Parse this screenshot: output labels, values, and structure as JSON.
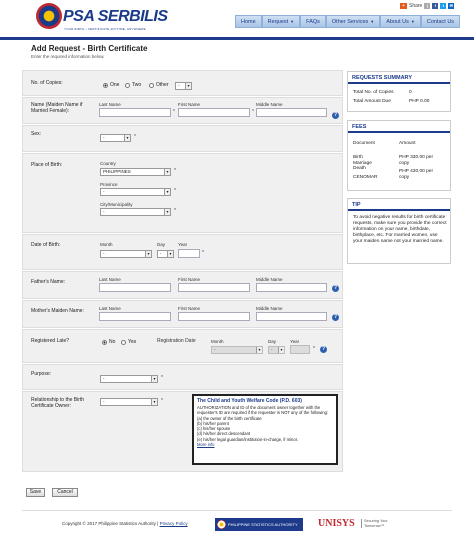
{
  "header": {
    "logo_text": "PSA SERBILIS",
    "tagline": "YOUR BIRTH • CERTIFICATE ANYTIME, ANYWHERE",
    "share_label": "Share",
    "nav": [
      {
        "label": "Home",
        "caret": false
      },
      {
        "label": "Request",
        "caret": true
      },
      {
        "label": "FAQs",
        "caret": false
      },
      {
        "label": "Other Services",
        "caret": true
      },
      {
        "label": "About Us",
        "caret": true
      },
      {
        "label": "Contact Us",
        "caret": false
      }
    ]
  },
  "page": {
    "title": "Add Request - Birth Certificate",
    "subtitle": "Enter the required information below."
  },
  "form": {
    "copies": {
      "label": "No. of Copies:",
      "options": [
        "One",
        "Two",
        "Other"
      ],
      "selected": "One",
      "other_value": "-"
    },
    "name": {
      "label": "Name (Maiden Name if Married Female):",
      "last": "Last Name",
      "first": "First Name",
      "middle": "Middle Name"
    },
    "sex": {
      "label": "Sex:",
      "value": "-"
    },
    "place_of_birth": {
      "label": "Place of Birth:",
      "country_label": "Country",
      "country_value": "PHILIPPINES",
      "province_label": "Province",
      "province_value": "-",
      "city_label": "City/Municipality",
      "city_value": "-"
    },
    "date_of_birth": {
      "label": "Date of Birth:",
      "month_label": "Month",
      "day_label": "Day",
      "year_label": "Year",
      "month_value": "-",
      "day_value": "-"
    },
    "father": {
      "label": "Father's Name:",
      "last": "Last Name",
      "first": "First Name",
      "middle": "Middle Name"
    },
    "mother": {
      "label": "Mother's Maiden Name:",
      "last": "Last Name",
      "first": "First Name",
      "middle": "Middle Name"
    },
    "registered_late": {
      "label": "Registered Late?",
      "options": [
        "No",
        "Yes"
      ],
      "selected": "No",
      "reg_date_label": "Registration Date",
      "month_label": "Month",
      "day_label": "Day",
      "year_label": "Year",
      "month_value": "-",
      "day_value": "-"
    },
    "purpose": {
      "label": "Purpose:",
      "value": "-"
    },
    "relationship": {
      "label": "Relationship to the Birth Certificate Owner:",
      "value": "-"
    },
    "asterisk": "*",
    "help": "?",
    "child_youth": {
      "title": "The Child and Youth Welfare Code (P.D. 603)",
      "intro": "AUTHORIZATION and ID of the document owner together with the requester's ID are required if the requester is NOT any of the following:",
      "items": [
        "(a) the owner of the birth certificate",
        "(b) his/her parent",
        "(c) his/her spouse",
        "(d) his/her direct descendant",
        "(e) his/her legal guardian/institution-in-charge, if minor."
      ],
      "more": "More info"
    }
  },
  "buttons": {
    "save": "Save",
    "cancel": "Cancel"
  },
  "sidebar": {
    "summary": {
      "title": "REQUESTS SUMMARY",
      "copies_label": "Total No. of Copies",
      "copies_value": "0",
      "amount_label": "Total Amount Due",
      "amount_value": "PHP 0.00"
    },
    "fees": {
      "title": "FEES",
      "col_document": "Document",
      "col_amount": "Amount",
      "row1_doc": "Birth Marriage Death",
      "row1_amount": "PHP 330.00 per copy",
      "row2_doc": "CENOMAR",
      "row2_amount": "PHP 430.00 per copy"
    },
    "tip": {
      "title": "TIP",
      "text": "To avoid negative results for birth certificate requests, make sure you provide the correct information on your name, birthdate, birthplace, etc. For married women, use your maiden name not your married name."
    }
  },
  "footer": {
    "copyright": "Copyright © 2017 Philippine Statistics Authority |",
    "privacy": "Privacy Policy",
    "psa_badge": "PHILIPPINE STATISTICS AUTHORITY",
    "unisys": "UNISYS",
    "unisys_tag": "Securing Your Tomorrow™"
  },
  "colors": {
    "brand_blue": "#1d3b8a",
    "nav_bg": "#b9d0ec",
    "brand_red": "#c0282d"
  }
}
